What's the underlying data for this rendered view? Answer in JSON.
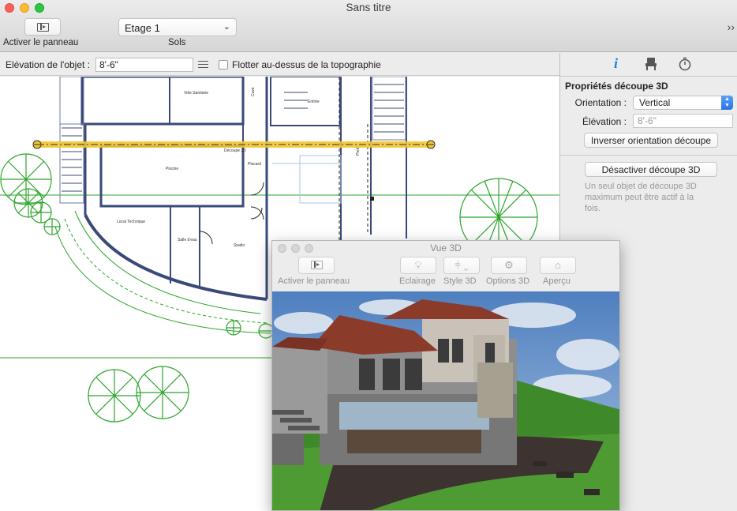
{
  "window": {
    "title": "Sans titre"
  },
  "toolbar": {
    "panel_button_label": "Activer le panneau",
    "floor_select_value": "Etage 1",
    "floor_select_label": "Sols"
  },
  "options_bar": {
    "elevation_label": "Elévation de l'objet :",
    "elevation_value": "8'-6\"",
    "float_label": "Flotter au-dessus de la topographie"
  },
  "plan": {
    "rooms": [
      "Vide Sanitaire",
      "Cave",
      "Entrée",
      "Piscine",
      "Placard",
      "Local Technique",
      "Salle d'eau",
      "Studio",
      "Porti"
    ],
    "cut_label": "Découpe 3D"
  },
  "inspector": {
    "heading": "Propriétés découpe 3D",
    "orientation_label": "Orientation :",
    "orientation_value": "Vertical",
    "elevation_label": "Élévation :",
    "elevation_value": "8'-6\"",
    "invert_button": "Inverser orientation découpe",
    "deactivate_button": "Désactiver découpe 3D",
    "note": "Un seul objet de découpe 3D maximum peut être actif à la fois."
  },
  "view3d": {
    "title": "Vue 3D",
    "buttons": [
      {
        "label": "Activer le panneau",
        "icon": "panel-icon"
      },
      {
        "label": "Eclairage",
        "icon": "bulb-icon"
      },
      {
        "label": "Style 3D",
        "icon": "brush-icon"
      },
      {
        "label": "Options 3D",
        "icon": "gear-icon"
      },
      {
        "label": "Aperçu",
        "icon": "house-icon"
      }
    ]
  },
  "colors": {
    "accent": "#2872e8",
    "cut_line": "#f2c530",
    "terrain": "#2aa52a",
    "walls": "#3a4a78"
  }
}
